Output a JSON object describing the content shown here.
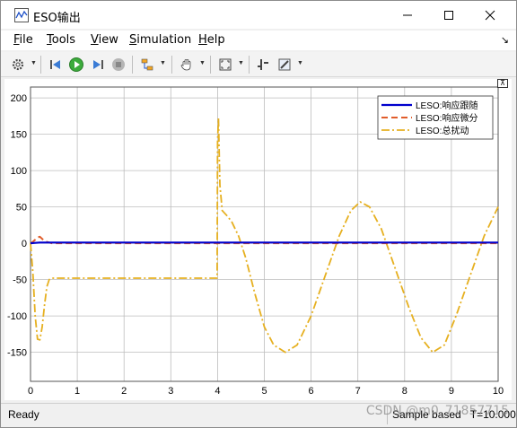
{
  "window": {
    "title": "ESO输出",
    "minimize_icon": "minimize-icon",
    "maximize_icon": "maximize-icon",
    "close_icon": "close-icon"
  },
  "menu": [
    {
      "label": "File",
      "mnemonic": "F",
      "rest": "ile"
    },
    {
      "label": "Tools",
      "mnemonic": "T",
      "rest": "ools"
    },
    {
      "label": "View",
      "mnemonic": "V",
      "rest": "iew"
    },
    {
      "label": "Simulation",
      "mnemonic": "S",
      "rest": "imulation"
    },
    {
      "label": "Help",
      "mnemonic": "H",
      "rest": "elp"
    }
  ],
  "toolbar": {
    "icons": [
      "gear-icon",
      "step-back-icon",
      "run-icon",
      "step-forward-icon",
      "stop-icon",
      "signal-select-icon",
      "pan-icon",
      "zoom-fit-icon",
      "cursor-measure-icon",
      "style-icon"
    ]
  },
  "status": {
    "left": "Ready",
    "right": "Sample based",
    "time": "T=10.000"
  },
  "watermark": "CSDN @m0_71857715",
  "colors": {
    "series1": "#0000cd",
    "series2": "#e15d2b",
    "series3": "#e6b020"
  },
  "chart_data": {
    "type": "line",
    "xlim": [
      0,
      10
    ],
    "ylim": [
      -190,
      215
    ],
    "xticks": [
      "0",
      "1",
      "2",
      "3",
      "4",
      "5",
      "6",
      "7",
      "8",
      "9",
      "10"
    ],
    "yticks": [
      "200",
      "150",
      "100",
      "50",
      "0",
      "-50",
      "-100",
      "-150"
    ],
    "grid": true,
    "legend_position": "top-right",
    "series": [
      {
        "name": "LESO:响应跟随",
        "style": "solid",
        "x": [
          0,
          0.1,
          0.2,
          0.5,
          1,
          2,
          3,
          4,
          5,
          6,
          7,
          8,
          9,
          10
        ],
        "y": [
          0,
          0.5,
          1,
          1,
          1,
          1,
          1,
          1,
          1,
          1,
          1,
          1,
          1,
          1
        ]
      },
      {
        "name": "LESO:响应微分",
        "style": "dashed",
        "x": [
          0,
          0.05,
          0.1,
          0.15,
          0.2,
          0.3,
          0.45,
          1,
          2,
          3,
          4,
          5,
          6,
          7,
          8,
          9,
          10
        ],
        "y": [
          0,
          2,
          5,
          8,
          9,
          3,
          0,
          0,
          0,
          0,
          0,
          0,
          0,
          0,
          0,
          0,
          0
        ]
      },
      {
        "name": "LESO:总扰动",
        "style": "dashdot",
        "x": [
          0,
          0.05,
          0.1,
          0.15,
          0.2,
          0.25,
          0.3,
          0.35,
          0.4,
          0.45,
          0.5,
          1,
          2,
          3,
          3.99,
          4.0,
          4.02,
          4.05,
          4.1,
          4.2,
          4.3,
          4.45,
          4.6,
          4.8,
          5.0,
          5.2,
          5.45,
          5.7,
          6.0,
          6.3,
          6.6,
          6.85,
          7.05,
          7.25,
          7.5,
          7.8,
          8.1,
          8.35,
          8.6,
          8.85,
          9.1,
          9.4,
          9.7,
          10.0
        ],
        "y": [
          0,
          -40,
          -100,
          -132,
          -133,
          -115,
          -85,
          -60,
          -50,
          -48,
          -48,
          -48,
          -48,
          -48,
          -48,
          140,
          172,
          80,
          45,
          38,
          30,
          10,
          -20,
          -70,
          -115,
          -140,
          -150,
          -140,
          -100,
          -45,
          10,
          45,
          57,
          50,
          20,
          -35,
          -90,
          -130,
          -150,
          -140,
          -100,
          -45,
          10,
          50
        ]
      }
    ]
  }
}
